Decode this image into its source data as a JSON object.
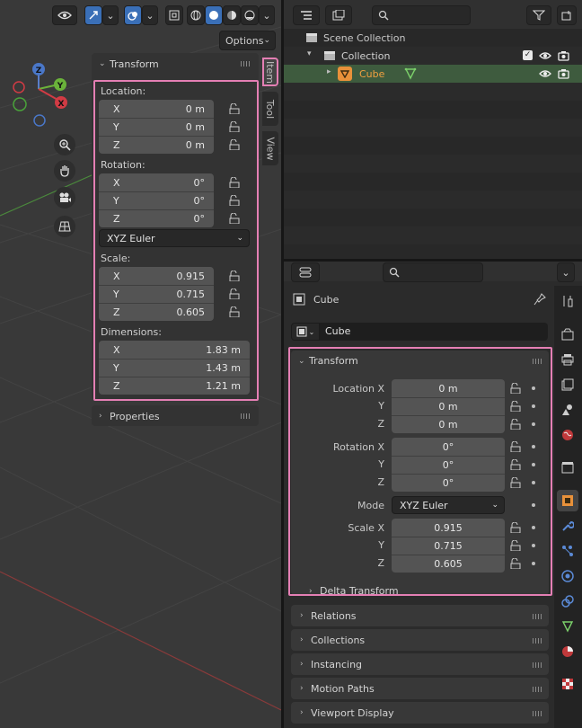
{
  "viewport": {
    "options_label": "Options",
    "sidebar_tabs": [
      "Item",
      "Tool",
      "View"
    ],
    "gizmo": {
      "z": "Z",
      "y": "Y",
      "x": "X"
    },
    "transform_panel": {
      "title": "Transform",
      "location_label": "Location:",
      "location": [
        {
          "axis": "X",
          "value": "0 m"
        },
        {
          "axis": "Y",
          "value": "0 m"
        },
        {
          "axis": "Z",
          "value": "0 m"
        }
      ],
      "rotation_label": "Rotation:",
      "rotation": [
        {
          "axis": "X",
          "value": "0°"
        },
        {
          "axis": "Y",
          "value": "0°"
        },
        {
          "axis": "Z",
          "value": "0°"
        }
      ],
      "rotation_mode": "XYZ Euler",
      "scale_label": "Scale:",
      "scale": [
        {
          "axis": "X",
          "value": "0.915"
        },
        {
          "axis": "Y",
          "value": "0.715"
        },
        {
          "axis": "Z",
          "value": "0.605"
        }
      ],
      "dimensions_label": "Dimensions:",
      "dimensions": [
        {
          "axis": "X",
          "value": "1.83 m"
        },
        {
          "axis": "Y",
          "value": "1.43 m"
        },
        {
          "axis": "Z",
          "value": "1.21 m"
        }
      ]
    },
    "properties_panel": {
      "title": "Properties"
    }
  },
  "outliner": {
    "scene_collection": "Scene Collection",
    "collection": "Collection",
    "cube": "Cube"
  },
  "properties": {
    "object_name_header": "Cube",
    "object_name_field": "Cube",
    "transform": {
      "title": "Transform",
      "location_labels": [
        "Location X",
        "Y",
        "Z"
      ],
      "location_values": [
        "0 m",
        "0 m",
        "0 m"
      ],
      "rotation_labels": [
        "Rotation X",
        "Y",
        "Z"
      ],
      "rotation_values": [
        "0°",
        "0°",
        "0°"
      ],
      "mode_label": "Mode",
      "mode_value": "XYZ Euler",
      "scale_labels": [
        "Scale X",
        "Y",
        "Z"
      ],
      "scale_values": [
        "0.915",
        "0.715",
        "0.605"
      ],
      "delta_transform": "Delta Transform"
    },
    "subpanels": [
      "Relations",
      "Collections",
      "Instancing",
      "Motion Paths",
      "Viewport Display"
    ]
  },
  "colors": {
    "highlight_box": "#e47fb4",
    "active_blue": "#3a6fb7",
    "object_orange": "#e8913a",
    "selected_row": "#3d5a3d"
  }
}
